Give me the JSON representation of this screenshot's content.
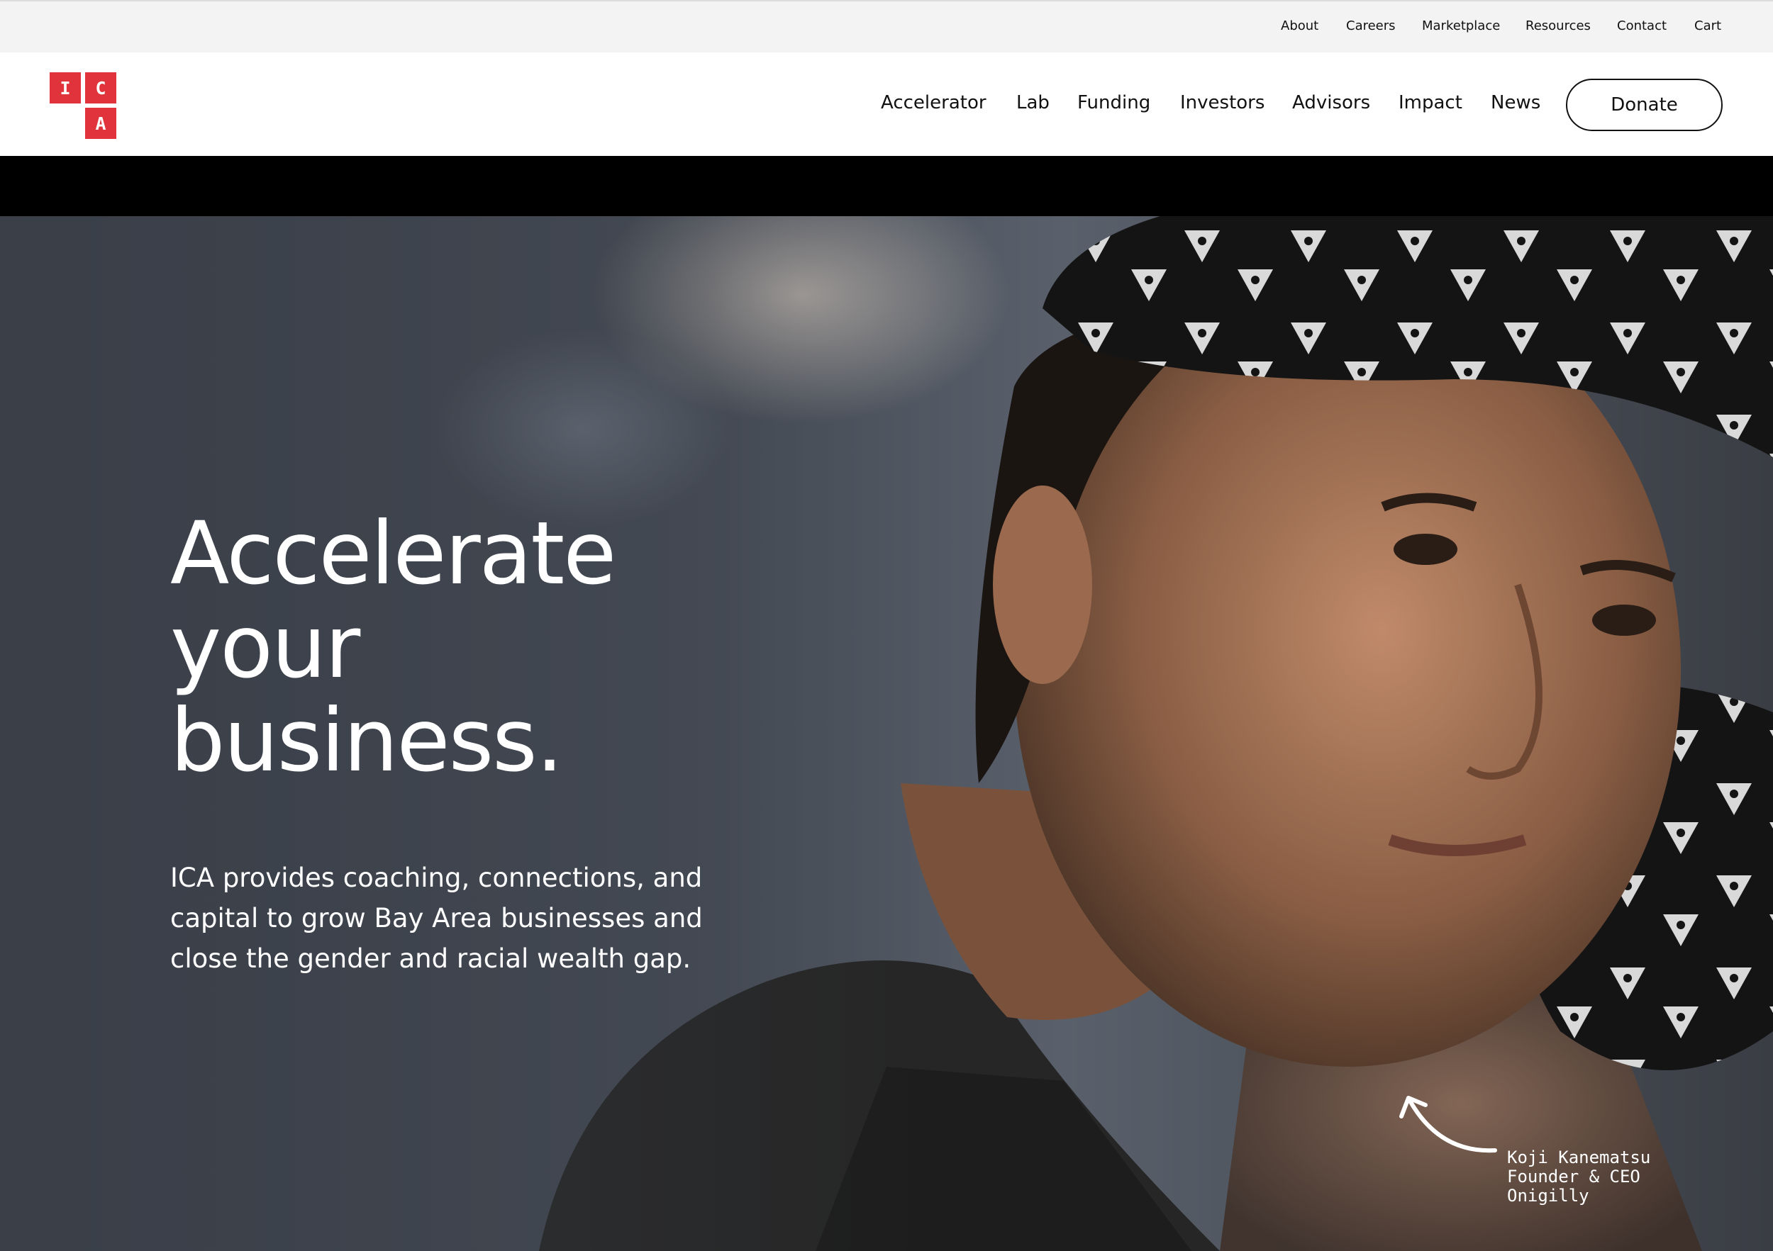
{
  "utility_nav": [
    "About",
    "Careers",
    "Marketplace",
    "Resources",
    "Contact",
    "Cart"
  ],
  "logo": {
    "letters": [
      "I",
      "C",
      "A"
    ],
    "color": "#e0333c"
  },
  "main_nav": [
    "Accelerator",
    "Lab",
    "Funding",
    "Investors",
    "Advisors",
    "Impact",
    "News"
  ],
  "donate_label": "Donate",
  "hero": {
    "title_lines": [
      "Accelerate",
      "your",
      "business."
    ],
    "subtitle": "ICA provides coaching, connections, and capital to grow Bay Area businesses and close the gender and racial wealth gap.",
    "caption": {
      "name": "Koji Kanematsu",
      "role": "Founder & CEO",
      "company": "Onigilly"
    }
  },
  "icons": {
    "arrow": "curved-arrow-icon"
  }
}
